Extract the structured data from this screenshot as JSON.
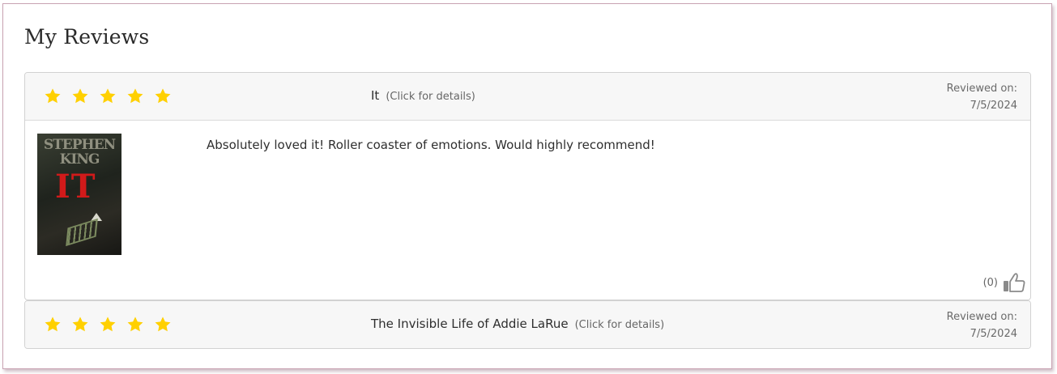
{
  "page": {
    "title": "My Reviews"
  },
  "colors": {
    "star": "#FFD000",
    "thumb": "#8a8a8a"
  },
  "reviews": [
    {
      "rating": 5,
      "title": "It",
      "details_link": "(Click for details)",
      "reviewed_label": "Reviewed on:",
      "reviewed_date": "7/5/2024",
      "cover": {
        "author_line1": "STEPHEN",
        "author_line2": "KING",
        "cover_title": "IT"
      },
      "text": "Absolutely loved it! Roller coaster of emotions. Would highly recommend!",
      "likes": "(0)",
      "like_icon": "thumbs-up-icon"
    },
    {
      "rating": 5,
      "title": "The Invisible Life of Addie LaRue",
      "details_link": "(Click for details)",
      "reviewed_label": "Reviewed on:",
      "reviewed_date": "7/5/2024"
    }
  ]
}
